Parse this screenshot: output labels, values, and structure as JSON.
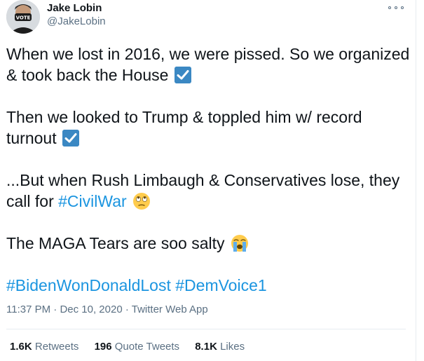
{
  "author": {
    "name": "Jake Lobin",
    "handle": "@JakeLobin",
    "avatar_mask_text": "VOTE"
  },
  "tweet": {
    "lines": {
      "p1a": "When we lost in 2016, we were pissed. So we organized",
      "p1b": "& took back the House",
      "p2a": "Then we looked to Trump & toppled him w/ record",
      "p2b": "turnout",
      "p3a": "...But when Rush Limbaugh & Conservatives lose, they",
      "p3b": "call for ",
      "p3_hashtag": "#CivilWar",
      "p4": "The MAGA Tears are soo salty",
      "hashtag1": "#BidenWonDonaldLost",
      "hashtag2": "#DemVoice1"
    },
    "emojis": [
      "check-mark-button",
      "check-mark-button",
      "face-with-rolling-eyes",
      "loudly-crying-face"
    ]
  },
  "meta": {
    "time": "11:37 PM",
    "separator": "·",
    "date": "Dec 10, 2020",
    "source": "Twitter Web App"
  },
  "stats": {
    "retweets_count": "1.6K",
    "retweets_label": "Retweets",
    "quotes_count": "196",
    "quotes_label": "Quote Tweets",
    "likes_count": "8.1K",
    "likes_label": "Likes"
  },
  "colors": {
    "link": "#1b95e0",
    "secondary_text": "#5b7083",
    "primary_text": "#0f1419",
    "divider": "#e6ecf0"
  }
}
